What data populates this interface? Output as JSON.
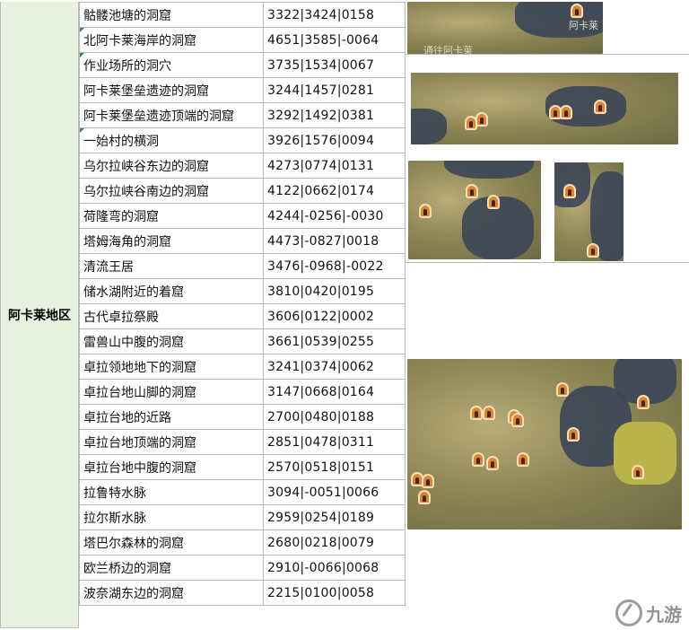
{
  "region": "阿卡莱地区",
  "rows": [
    {
      "name": "骷髅池塘的洞窟",
      "coord": "3322|3424|0158",
      "tick": false
    },
    {
      "name": " 北阿卡莱海岸的洞窟",
      "coord": "4651|3585|-0064",
      "tick": true
    },
    {
      "name": " 作业场所的洞穴",
      "coord": "3735|1534|0067",
      "tick": true
    },
    {
      "name": "阿卡莱堡垒遗迹的洞窟",
      "coord": "3244|1457|0281",
      "tick": false
    },
    {
      "name": "阿卡莱堡垒遗迹顶端的洞窟",
      "coord": "3292|1492|0381",
      "tick": false
    },
    {
      "name": " 一始村的横洞",
      "coord": "3926|1576|0094",
      "tick": true
    },
    {
      "name": "乌尔拉峡谷东边的洞窟",
      "coord": "4273|0774|0131",
      "tick": false
    },
    {
      "name": "乌尔拉峡谷南边的洞窟",
      "coord": "4122|0662|0174",
      "tick": false
    },
    {
      "name": "荷隆弯的洞窟",
      "coord": "4244|-0256|-0030",
      "tick": false
    },
    {
      "name": "塔姆海角的洞窟",
      "coord": "4473|-0827|0018",
      "tick": false
    },
    {
      "name": "清流王居",
      "coord": "3476|-0968|-0022",
      "tick": false
    },
    {
      "name": "储水湖附近的着窟",
      "coord": "3810|0420|0195",
      "tick": false
    },
    {
      "name": "古代卓拉祭殿",
      "coord": "3606|0122|0002",
      "tick": false
    },
    {
      "name": "雷兽山中腹的洞窟",
      "coord": "3661|0539|0255",
      "tick": false
    },
    {
      "name": "卓拉领地地下的洞窟",
      "coord": "3241|0374|0062",
      "tick": false
    },
    {
      "name": "卓拉台地山脚的洞窟",
      "coord": "3147|0668|0164",
      "tick": false
    },
    {
      "name": "卓拉台地的近路",
      "coord": "2700|0480|0188",
      "tick": false
    },
    {
      "name": "卓拉台地顶端的洞窟",
      "coord": "2851|0478|0311",
      "tick": false
    },
    {
      "name": "卓拉台地中腹的洞窟",
      "coord": "2570|0518|0151",
      "tick": false
    },
    {
      "name": "拉鲁特水脉",
      "coord": "3094|-0051|0066",
      "tick": false
    },
    {
      "name": "拉尔斯水脉",
      "coord": "2959|0254|0189",
      "tick": false
    },
    {
      "name": "塔巴尔森林的洞窟",
      "coord": "2680|0218|0079",
      "tick": false
    },
    {
      "name": "欧兰桥边的洞窟",
      "coord": "2910|-0066|0068",
      "tick": false
    },
    {
      "name": "波奈湖东边的洞窟",
      "coord": "2215|0100|0058",
      "tick": false
    }
  ],
  "map_labels": {
    "top_right": "阿卡莱",
    "top_bottom": "通往阿卡莱"
  },
  "watermark": {
    "text": "九游",
    "icon": "jiuyou-logo-icon"
  },
  "colors": {
    "region_bg": "#e8f0e0",
    "grid_line": "#b9b9b9",
    "pin": "#e0852e",
    "tick": "#2e8b3d"
  }
}
